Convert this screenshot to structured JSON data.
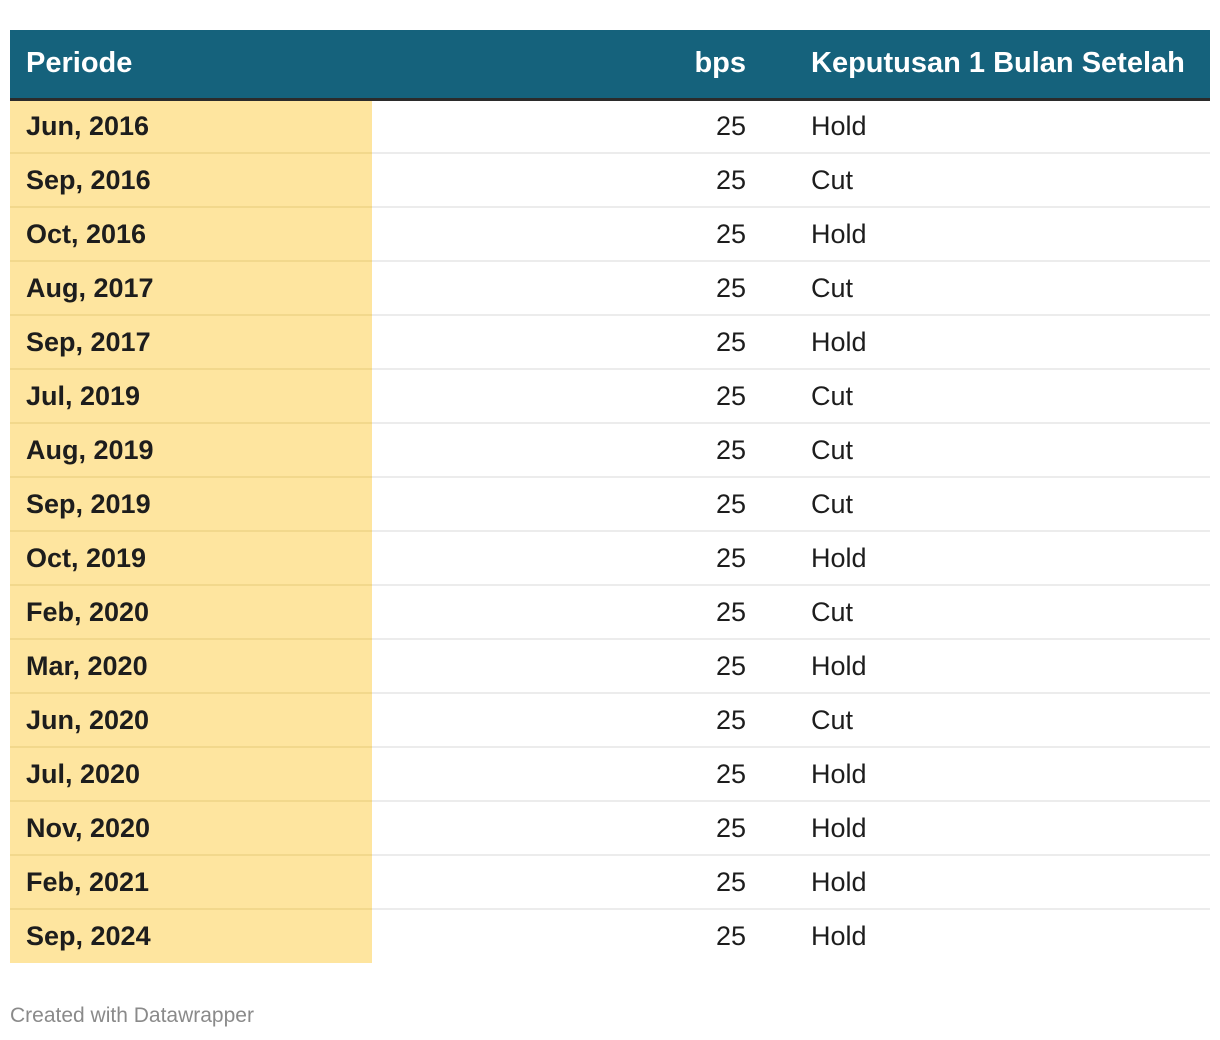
{
  "chart_data": {
    "type": "table",
    "columns": [
      "Periode",
      "bps",
      "Keputusan 1 Bulan Setelah"
    ],
    "rows": [
      {
        "periode": "Jun, 2016",
        "bps": "25",
        "keputusan": "Hold"
      },
      {
        "periode": "Sep, 2016",
        "bps": "25",
        "keputusan": "Cut"
      },
      {
        "periode": "Oct, 2016",
        "bps": "25",
        "keputusan": "Hold"
      },
      {
        "periode": "Aug, 2017",
        "bps": "25",
        "keputusan": "Cut"
      },
      {
        "periode": "Sep, 2017",
        "bps": "25",
        "keputusan": "Hold"
      },
      {
        "periode": "Jul, 2019",
        "bps": "25",
        "keputusan": "Cut"
      },
      {
        "periode": "Aug, 2019",
        "bps": "25",
        "keputusan": "Cut"
      },
      {
        "periode": "Sep, 2019",
        "bps": "25",
        "keputusan": "Cut"
      },
      {
        "periode": "Oct, 2019",
        "bps": "25",
        "keputusan": "Hold"
      },
      {
        "periode": "Feb, 2020",
        "bps": "25",
        "keputusan": "Cut"
      },
      {
        "periode": "Mar, 2020",
        "bps": "25",
        "keputusan": "Hold"
      },
      {
        "periode": "Jun, 2020",
        "bps": "25",
        "keputusan": "Cut"
      },
      {
        "periode": "Jul, 2020",
        "bps": "25",
        "keputusan": "Hold"
      },
      {
        "periode": "Nov, 2020",
        "bps": "25",
        "keputusan": "Hold"
      },
      {
        "periode": "Feb, 2021",
        "bps": "25",
        "keputusan": "Hold"
      },
      {
        "periode": "Sep, 2024",
        "bps": "25",
        "keputusan": "Hold"
      }
    ],
    "header_color": "#15627c",
    "highlight_column_color": "#fee59f"
  },
  "footer": {
    "credit": "Created with Datawrapper"
  }
}
